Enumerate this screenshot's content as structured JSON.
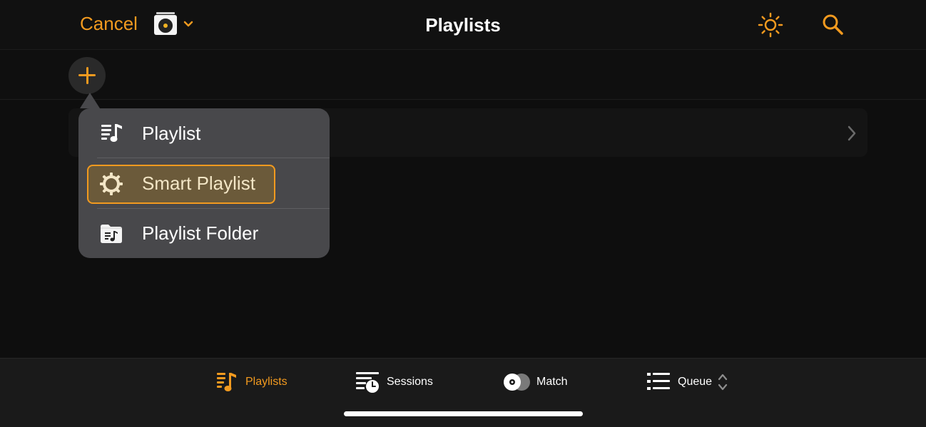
{
  "header": {
    "cancel_label": "Cancel",
    "title": "Playlists",
    "source_icon": "record-crate-icon",
    "brightness_icon": "sun-icon",
    "search_icon": "search-icon"
  },
  "toolbar": {
    "add_icon": "plus-icon"
  },
  "popover_menu": {
    "items": [
      {
        "label": "Playlist",
        "icon": "playlist-icon",
        "selected": false
      },
      {
        "label": "Smart Playlist",
        "icon": "gear-icon",
        "selected": true
      },
      {
        "label": "Playlist Folder",
        "icon": "folder-music-icon",
        "selected": false
      }
    ]
  },
  "tabbar": {
    "tabs": [
      {
        "label": "Playlists",
        "icon": "playlist-icon",
        "active": true
      },
      {
        "label": "Sessions",
        "icon": "sessions-icon",
        "active": false
      },
      {
        "label": "Match",
        "icon": "match-icon",
        "active": false
      },
      {
        "label": "Queue",
        "icon": "queue-icon",
        "active": false
      }
    ]
  },
  "colors": {
    "accent": "#f29a1f",
    "background": "#0e0e0e",
    "popover": "#48484b",
    "selected_fill": "#6b5a3a"
  }
}
